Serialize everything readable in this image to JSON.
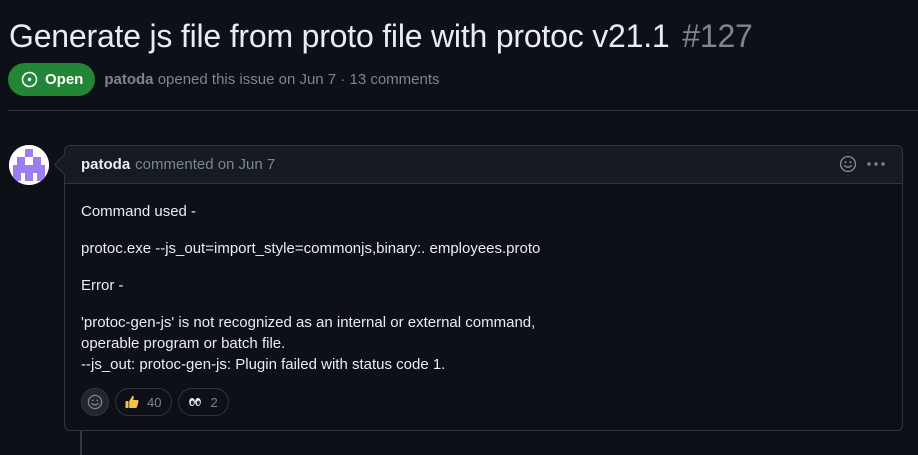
{
  "issue": {
    "title": "Generate js file from proto file with protoc v21.1",
    "number": "#127",
    "state": "Open",
    "author": "patoda",
    "meta": "opened this issue on Jun 7 · 13 comments"
  },
  "comment": {
    "author": "patoda",
    "action": "commented on Jun 7",
    "body": [
      "Command used -",
      "protoc.exe --js_out=import_style=commonjs,binary:. employees.proto",
      "Error -",
      "'protoc-gen-js' is not recognized as an internal or external command,",
      "operable program or batch file.",
      "--js_out: protoc-gen-js: Plugin failed with status code 1."
    ],
    "reactions": [
      {
        "icon": "thumbs-up-icon",
        "count": "40"
      },
      {
        "icon": "eyes-icon",
        "count": "2"
      }
    ]
  },
  "colors": {
    "background": "#0d1117",
    "open_badge": "#238636",
    "muted_text": "#7d8590",
    "border": "#30363d",
    "avatar_purple": "#9c7ef0"
  }
}
